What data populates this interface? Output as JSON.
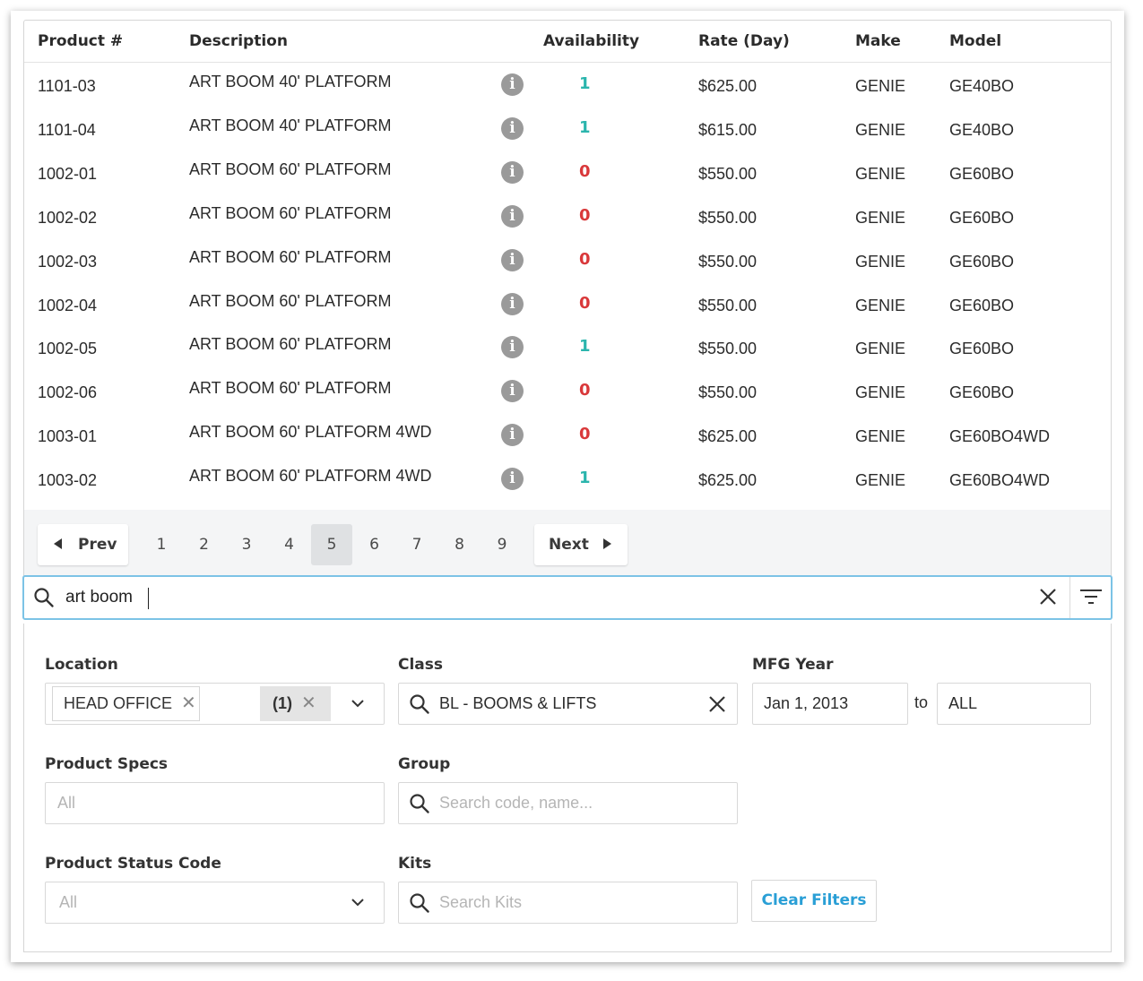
{
  "table": {
    "columns": {
      "product": "Product #",
      "description": "Description",
      "availability": "Availability",
      "rate": "Rate (Day)",
      "make": "Make",
      "model": "Model"
    },
    "rows": [
      {
        "product": "1101-03",
        "description": "ART BOOM 40' PLATFORM",
        "availability": "1",
        "rate": "$625.00",
        "make": "GENIE",
        "model": "GE40BO"
      },
      {
        "product": "1101-04",
        "description": "ART BOOM 40' PLATFORM",
        "availability": "1",
        "rate": "$615.00",
        "make": "GENIE",
        "model": "GE40BO"
      },
      {
        "product": "1002-01",
        "description": "ART BOOM 60' PLATFORM",
        "availability": "0",
        "rate": "$550.00",
        "make": "GENIE",
        "model": "GE60BO"
      },
      {
        "product": "1002-02",
        "description": "ART BOOM 60' PLATFORM",
        "availability": "0",
        "rate": "$550.00",
        "make": "GENIE",
        "model": "GE60BO"
      },
      {
        "product": "1002-03",
        "description": "ART BOOM 60' PLATFORM",
        "availability": "0",
        "rate": "$550.00",
        "make": "GENIE",
        "model": "GE60BO"
      },
      {
        "product": "1002-04",
        "description": "ART BOOM 60' PLATFORM",
        "availability": "0",
        "rate": "$550.00",
        "make": "GENIE",
        "model": "GE60BO"
      },
      {
        "product": "1002-05",
        "description": "ART BOOM 60' PLATFORM",
        "availability": "1",
        "rate": "$550.00",
        "make": "GENIE",
        "model": "GE60BO"
      },
      {
        "product": "1002-06",
        "description": "ART BOOM 60' PLATFORM",
        "availability": "0",
        "rate": "$550.00",
        "make": "GENIE",
        "model": "GE60BO"
      },
      {
        "product": "1003-01",
        "description": "ART BOOM 60' PLATFORM 4WD",
        "availability": "0",
        "rate": "$625.00",
        "make": "GENIE",
        "model": "GE60BO4WD"
      },
      {
        "product": "1003-02",
        "description": "ART BOOM 60' PLATFORM 4WD",
        "availability": "1",
        "rate": "$625.00",
        "make": "GENIE",
        "model": "GE60BO4WD"
      }
    ],
    "info_icon": "info-circle-icon",
    "info_glyph": "i"
  },
  "colors": {
    "available": "#2bb5ad",
    "unavailable": "#d9383a",
    "accent": "#2a9fd6",
    "search_border": "#7cc3e6"
  },
  "pagination": {
    "prev_label": "Prev",
    "next_label": "Next",
    "pages": [
      "1",
      "2",
      "3",
      "4",
      "5",
      "6",
      "7",
      "8",
      "9"
    ],
    "current_page": "5"
  },
  "search": {
    "value": "art boom",
    "icon": "search-icon",
    "clear_icon": "close-icon",
    "filter_icon": "filter-icon"
  },
  "filters": {
    "location": {
      "label": "Location",
      "chip": "HEAD OFFICE",
      "count": "(1)"
    },
    "class": {
      "label": "Class",
      "value": "BL - BOOMS & LIFTS"
    },
    "mfg_year": {
      "label": "MFG Year",
      "from": "Jan 1, 2013",
      "separator": "to",
      "to": "ALL"
    },
    "product_specs": {
      "label": "Product Specs",
      "placeholder": "All"
    },
    "group": {
      "label": "Group",
      "placeholder": "Search code, name..."
    },
    "product_status_code": {
      "label": "Product Status Code",
      "value": "All"
    },
    "kits": {
      "label": "Kits",
      "placeholder": "Search Kits"
    },
    "clear_label": "Clear Filters"
  }
}
